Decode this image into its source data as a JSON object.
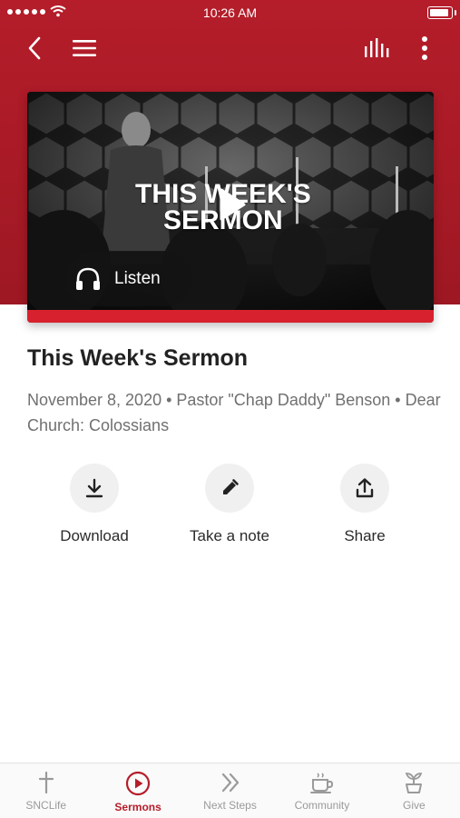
{
  "status_bar": {
    "time": "10:26 AM"
  },
  "header": {
    "back_icon": "chevron-left-icon",
    "menu_icon": "hamburger-icon",
    "audio_icon": "audio-bars-icon",
    "more_icon": "vertical-dots-icon",
    "brand_color": "#b51d2a"
  },
  "media": {
    "thumbnail_title_line1": "THIS WEEK'S",
    "thumbnail_title_line2": "SERMON",
    "listen_label": "Listen"
  },
  "sermon": {
    "title": "This Week's Sermon",
    "meta": "November 8, 2020 • Pastor \"Chap Daddy\" Benson • Dear Church: Colossians"
  },
  "actions": [
    {
      "label": "Download",
      "icon": "download-icon"
    },
    {
      "label": "Take a note",
      "icon": "pencil-icon"
    },
    {
      "label": "Share",
      "icon": "share-icon"
    }
  ],
  "tabs": [
    {
      "label": "SNCLife",
      "icon": "cross-icon",
      "active": false
    },
    {
      "label": "Sermons",
      "icon": "play-circle-icon",
      "active": true
    },
    {
      "label": "Next Steps",
      "icon": "double-chevron-icon",
      "active": false
    },
    {
      "label": "Community",
      "icon": "coffee-cup-icon",
      "active": false
    },
    {
      "label": "Give",
      "icon": "plant-icon",
      "active": false
    }
  ]
}
